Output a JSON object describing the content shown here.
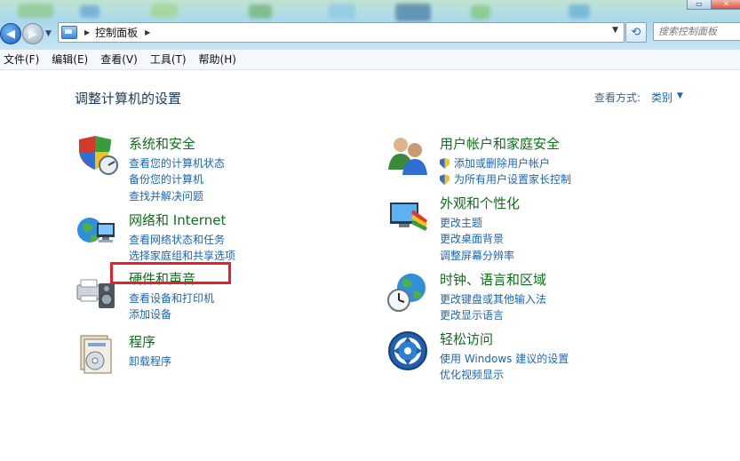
{
  "address_bar": {
    "breadcrumb": "控制面板",
    "search_placeholder": "搜索控制面板"
  },
  "menubar": {
    "items": [
      "文件(F)",
      "编辑(E)",
      "查看(V)",
      "工具(T)",
      "帮助(H)"
    ]
  },
  "main": {
    "title": "调整计算机的设置",
    "view_by_label": "查看方式:",
    "view_by_value": "类别"
  },
  "categories": [
    {
      "title": "系统和安全",
      "icon": "system-security-icon",
      "links": [
        "查看您的计算机状态",
        "备份您的计算机",
        "查找并解决问题"
      ]
    },
    {
      "title": "网络和 Internet",
      "icon": "network-internet-icon",
      "links": [
        "查看网络状态和任务",
        "选择家庭组和共享选项"
      ]
    },
    {
      "title": "硬件和声音",
      "icon": "hardware-sound-icon",
      "links": [
        "查看设备和打印机",
        "添加设备"
      ],
      "highlighted": true
    },
    {
      "title": "程序",
      "icon": "programs-icon",
      "links": [
        "卸载程序"
      ]
    },
    {
      "title": "用户帐户和家庭安全",
      "icon": "user-accounts-icon",
      "links": [
        "添加或删除用户帐户",
        "为所有用户设置家长控制"
      ]
    },
    {
      "title": "外观和个性化",
      "icon": "appearance-icon",
      "links": [
        "更改主题",
        "更改桌面背景",
        "调整屏幕分辨率"
      ]
    },
    {
      "title": "时钟、语言和区域",
      "icon": "clock-language-region-icon",
      "links": [
        "更改键盘或其他输入法",
        "更改显示语言"
      ]
    },
    {
      "title": "轻松访问",
      "icon": "ease-of-access-icon",
      "links": [
        "使用 Windows 建议的设置",
        "优化视频显示"
      ]
    }
  ],
  "colors": {
    "category_title": "#0f6e1a",
    "link": "#1a66b8",
    "page_title": "#1e395b",
    "highlight_box": "#e8202d"
  }
}
